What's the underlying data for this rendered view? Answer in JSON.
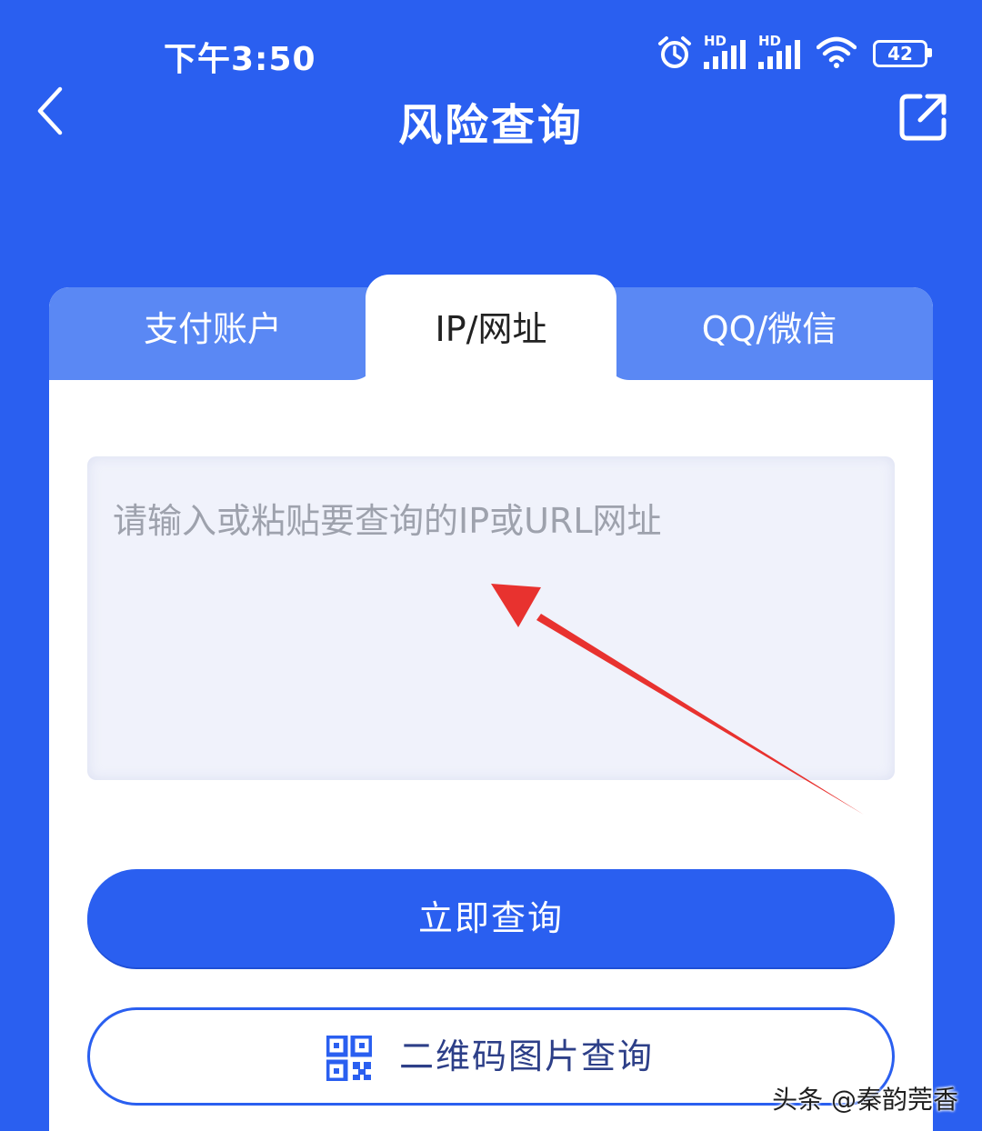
{
  "status_bar": {
    "time": "下午3:50",
    "signal_1_label": "HD",
    "signal_2_label": "HD",
    "battery": "42",
    "icons": [
      "alarm-icon",
      "signal-icon",
      "signal-icon",
      "wifi-icon",
      "battery-icon"
    ]
  },
  "nav": {
    "title": "风险查询",
    "back_icon": "chevron-left-icon",
    "share_icon": "share-external-icon"
  },
  "tabs": [
    {
      "label": "支付账户",
      "active": false
    },
    {
      "label": "IP/网址",
      "active": true
    },
    {
      "label": "QQ/微信",
      "active": false
    }
  ],
  "input": {
    "placeholder": "请输入或粘贴要查询的IP或URL网址",
    "value": ""
  },
  "buttons": {
    "query": "立即查询",
    "qr_query": "二维码图片查询"
  },
  "watermark": "头条 @秦韵莞香",
  "colors": {
    "brand_blue": "#2a5ff0",
    "tab_inactive": "#5a88f4",
    "input_bg": "#f0f2fb",
    "annotation_arrow": "#e8322f"
  }
}
